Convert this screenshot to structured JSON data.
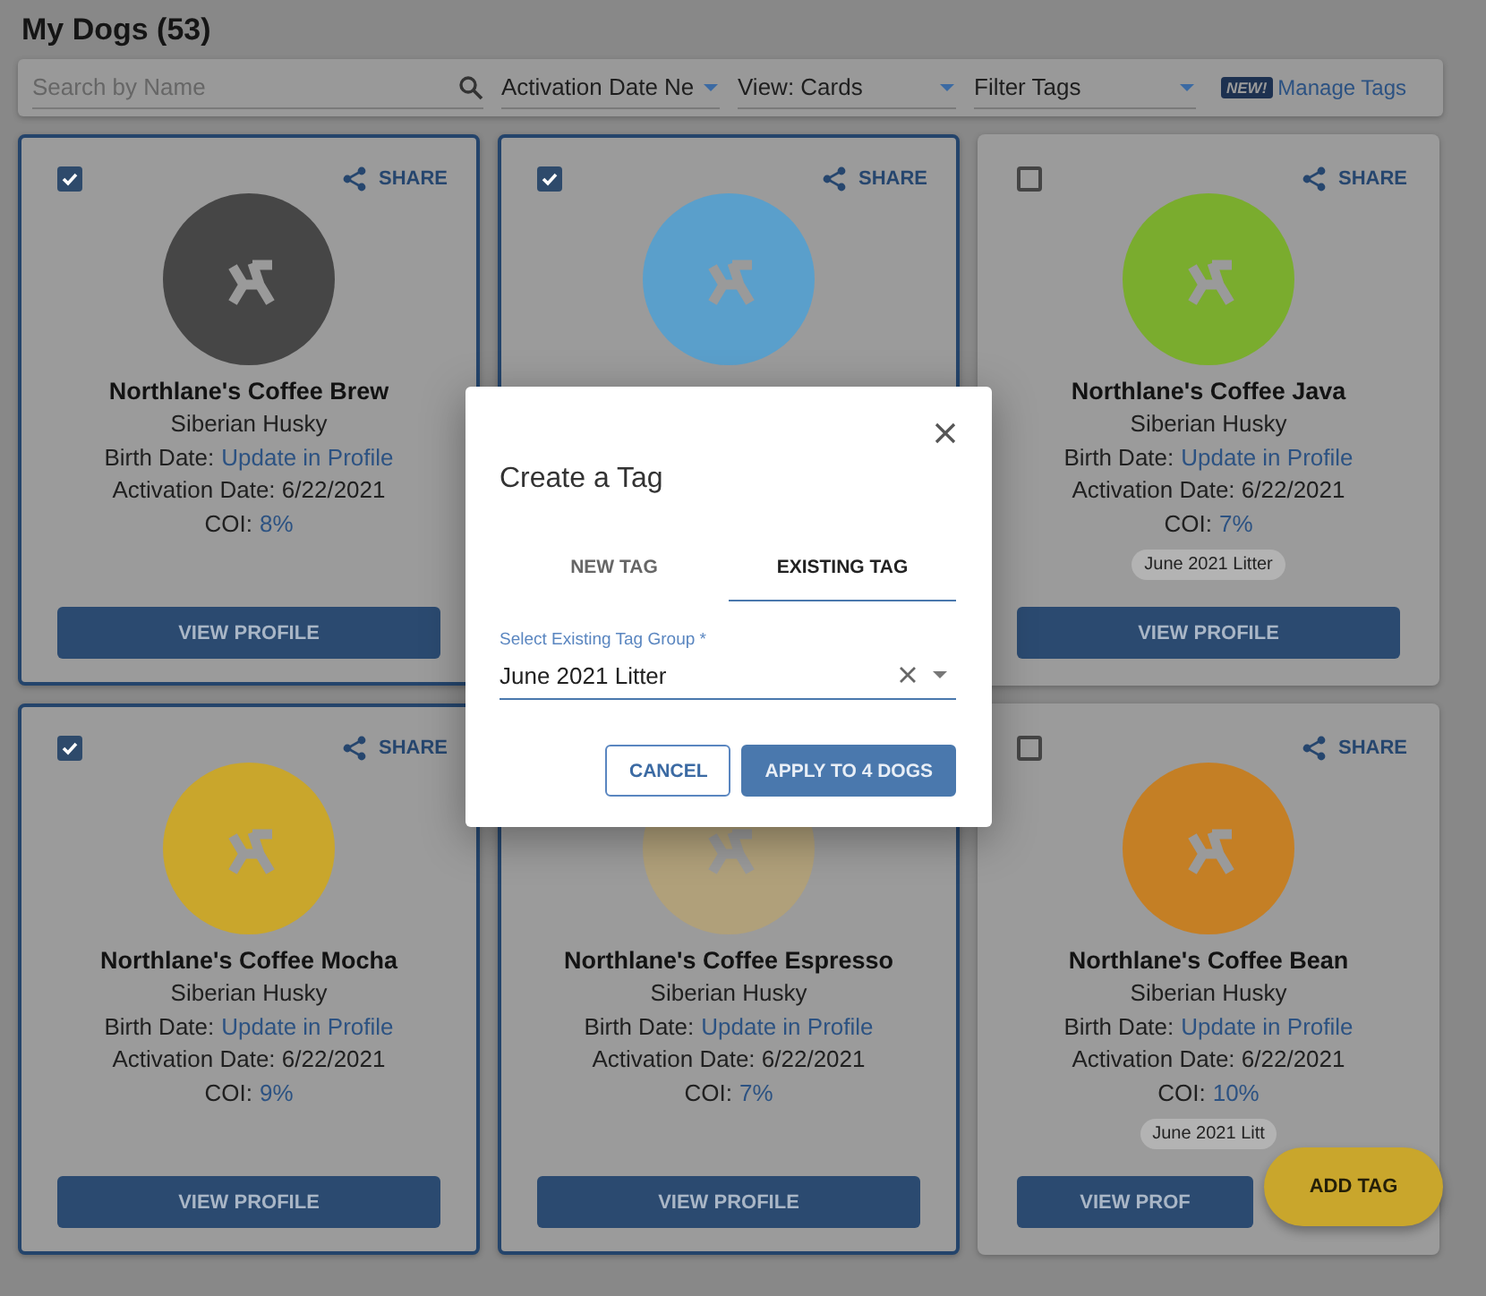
{
  "page_title": "My Dogs (53)",
  "toolbar": {
    "search": {
      "placeholder": "Search by Name"
    },
    "dropdowns": [
      {
        "value": "Activation Date Ne"
      },
      {
        "value": "View: Cards"
      },
      {
        "value": "Filter Tags"
      }
    ],
    "badge": "NEW!",
    "link": "Manage Tags"
  },
  "dogs": [
    {
      "selected": true,
      "checked": true,
      "share": "SHARE",
      "color": "#464646",
      "name": "Northlane's Coffee Brew",
      "breed": "Siberian Husky",
      "birth_label": "Birth Date:",
      "birth_link": "Update in Profile",
      "activation": "Activation Date: 6/22/2021",
      "coi_label": "COI:",
      "coi_value": "8%",
      "button": "VIEW PROFILE"
    },
    {
      "selected": true,
      "checked": true,
      "share": "SHARE",
      "color": "#5a9fcb"
    },
    {
      "selected": false,
      "checked": false,
      "share": "SHARE",
      "color": "#7aac2e",
      "name": "Northlane's Coffee Java",
      "breed": "Siberian Husky",
      "birth_label": "Birth Date:",
      "birth_link": "Update in Profile",
      "activation": "Activation Date: 6/22/2021",
      "coi_label": "COI:",
      "coi_value": "7%",
      "tag": "June 2021 Litter",
      "button": "VIEW PROFILE"
    },
    {
      "selected": true,
      "checked": true,
      "share": "SHARE",
      "color": "#c9a62c",
      "name": "Northlane's Coffee Mocha",
      "breed": "Siberian Husky",
      "birth_label": "Birth Date:",
      "birth_link": "Update in Profile",
      "activation": "Activation Date: 6/22/2021",
      "coi_label": "COI:",
      "coi_value": "9%",
      "button": "VIEW PROFILE"
    },
    {
      "selected": true,
      "color": "#b0a07a",
      "name": "Northlane's Coffee Espresso",
      "breed": "Siberian Husky",
      "birth_label": "Birth Date:",
      "birth_link": "Update in Profile",
      "activation": "Activation Date: 6/22/2021",
      "coi_label": "COI:",
      "coi_value": "7%",
      "button": "VIEW PROFILE"
    },
    {
      "selected": false,
      "checked": false,
      "share": "SHARE",
      "color": "#c47f25",
      "name": "Northlane's Coffee Bean",
      "breed": "Siberian Husky",
      "birth_label": "Birth Date:",
      "birth_link": "Update in Profile",
      "activation": "Activation Date: 6/22/2021",
      "coi_label": "COI:",
      "coi_value": "10%",
      "tag": "June 2021 Litt",
      "button": "VIEW PROF"
    }
  ],
  "fab": "ADD TAG",
  "dialog": {
    "title": "Create a Tag",
    "tabs": [
      {
        "label": "NEW TAG",
        "selected": false
      },
      {
        "label": "EXISTING TAG",
        "selected": true
      }
    ],
    "field": {
      "label": "Select Existing Tag Group *",
      "value": "June 2021 Litter"
    },
    "buttons": [
      {
        "label": "CANCEL",
        "kind": "outlined"
      },
      {
        "label": "APPLY TO 4 DOGS",
        "kind": "filled"
      }
    ]
  }
}
